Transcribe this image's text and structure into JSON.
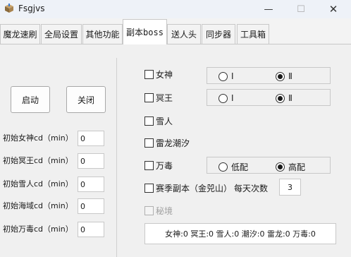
{
  "window": {
    "title": "Fsgjvs",
    "min_glyph": "—",
    "max_glyph": "☐",
    "close_glyph": "✕"
  },
  "tabs": [
    {
      "label": "魔龙速刷"
    },
    {
      "label": "全局设置"
    },
    {
      "label": "其他功能"
    },
    {
      "label": "副本boss"
    },
    {
      "label": "送人头"
    },
    {
      "label": "同步器"
    },
    {
      "label": "工具箱"
    }
  ],
  "active_tab": "副本boss",
  "left_panel": {
    "start_label": "启动",
    "stop_label": "关闭",
    "cd_rows": [
      {
        "label": "初始女神cd（min）",
        "value": "0"
      },
      {
        "label": "初始冥王cd（min）",
        "value": "0"
      },
      {
        "label": "初始雪人cd（min）",
        "value": "0"
      },
      {
        "label": "初始海域cd（min）",
        "value": "0"
      },
      {
        "label": "初始万毒cd（min）",
        "value": "0"
      }
    ]
  },
  "right_panel": {
    "bosses": [
      {
        "label": "女神",
        "checked": false,
        "options": [
          "Ⅰ",
          "Ⅱ"
        ],
        "selected": 1
      },
      {
        "label": "冥王",
        "checked": false,
        "options": [
          "Ⅰ",
          "Ⅱ"
        ],
        "selected": 1
      },
      {
        "label": "雪人",
        "checked": false
      },
      {
        "label": "雷龙潮汐",
        "checked": false
      },
      {
        "label": "万毒",
        "checked": false,
        "options": [
          "低配",
          "高配"
        ],
        "selected": 1
      }
    ],
    "season_dungeon_label": "赛季副本（金兕山）",
    "daily_times_label": "每天次数",
    "daily_times_value": "3",
    "secret_label": "秘境",
    "status_text": "女神:0 冥王:0 雪人:0 潮汐:0 雷龙:0 万毒:0"
  }
}
